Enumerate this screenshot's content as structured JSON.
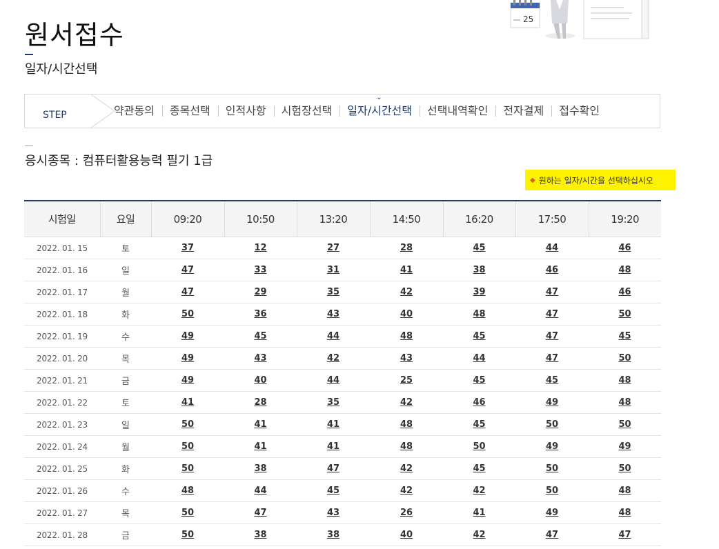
{
  "page": {
    "title": "원서접수",
    "subtitle": "일자/시간선택",
    "calendar_number": "25"
  },
  "steps": {
    "label": "STEP",
    "items": [
      {
        "label": "약관동의",
        "active": false
      },
      {
        "label": "종목선택",
        "active": false
      },
      {
        "label": "인적사항",
        "active": false
      },
      {
        "label": "시험장선택",
        "active": false
      },
      {
        "label": "일자/시간선택",
        "active": true
      },
      {
        "label": "선택내역확인",
        "active": false
      },
      {
        "label": "전자결제",
        "active": false
      },
      {
        "label": "접수확인",
        "active": false
      }
    ]
  },
  "exam": {
    "line": "응시종목 : 컴퓨터활용능력 필기 1급"
  },
  "notice": {
    "text": "원하는 일자/시간을 선택하십시오",
    "highlight_color": "#fff200"
  },
  "schedule": {
    "headers": [
      "시험일",
      "요일",
      "09:20",
      "10:50",
      "13:20",
      "14:50",
      "16:20",
      "17:50",
      "19:20"
    ],
    "rows": [
      {
        "date": "2022. 01. 15",
        "day": "토",
        "slots": [
          "37",
          "12",
          "27",
          "28",
          "45",
          "44",
          "46"
        ]
      },
      {
        "date": "2022. 01. 16",
        "day": "일",
        "slots": [
          "47",
          "33",
          "31",
          "41",
          "38",
          "46",
          "48"
        ]
      },
      {
        "date": "2022. 01. 17",
        "day": "월",
        "slots": [
          "47",
          "29",
          "35",
          "42",
          "39",
          "47",
          "46"
        ]
      },
      {
        "date": "2022. 01. 18",
        "day": "화",
        "slots": [
          "50",
          "36",
          "43",
          "40",
          "48",
          "47",
          "50"
        ]
      },
      {
        "date": "2022. 01. 19",
        "day": "수",
        "slots": [
          "49",
          "45",
          "44",
          "48",
          "45",
          "47",
          "45"
        ]
      },
      {
        "date": "2022. 01. 20",
        "day": "목",
        "slots": [
          "49",
          "43",
          "42",
          "43",
          "44",
          "47",
          "50"
        ]
      },
      {
        "date": "2022. 01. 21",
        "day": "금",
        "slots": [
          "49",
          "40",
          "44",
          "25",
          "45",
          "45",
          "48"
        ]
      },
      {
        "date": "2022. 01. 22",
        "day": "토",
        "slots": [
          "41",
          "28",
          "35",
          "42",
          "46",
          "49",
          "48"
        ]
      },
      {
        "date": "2022. 01. 23",
        "day": "일",
        "slots": [
          "50",
          "41",
          "41",
          "48",
          "45",
          "50",
          "50"
        ]
      },
      {
        "date": "2022. 01. 24",
        "day": "월",
        "slots": [
          "50",
          "41",
          "41",
          "48",
          "50",
          "49",
          "49"
        ]
      },
      {
        "date": "2022. 01. 25",
        "day": "화",
        "slots": [
          "50",
          "38",
          "47",
          "42",
          "45",
          "50",
          "50"
        ]
      },
      {
        "date": "2022. 01. 26",
        "day": "수",
        "slots": [
          "48",
          "44",
          "45",
          "42",
          "42",
          "50",
          "48"
        ]
      },
      {
        "date": "2022. 01. 27",
        "day": "목",
        "slots": [
          "50",
          "47",
          "43",
          "26",
          "41",
          "49",
          "48"
        ]
      },
      {
        "date": "2022. 01. 28",
        "day": "금",
        "slots": [
          "50",
          "38",
          "38",
          "40",
          "42",
          "47",
          "47"
        ]
      }
    ]
  },
  "colors": {
    "accent_navy": "#1d3a6e",
    "notice_icon": "#e35b1e"
  }
}
